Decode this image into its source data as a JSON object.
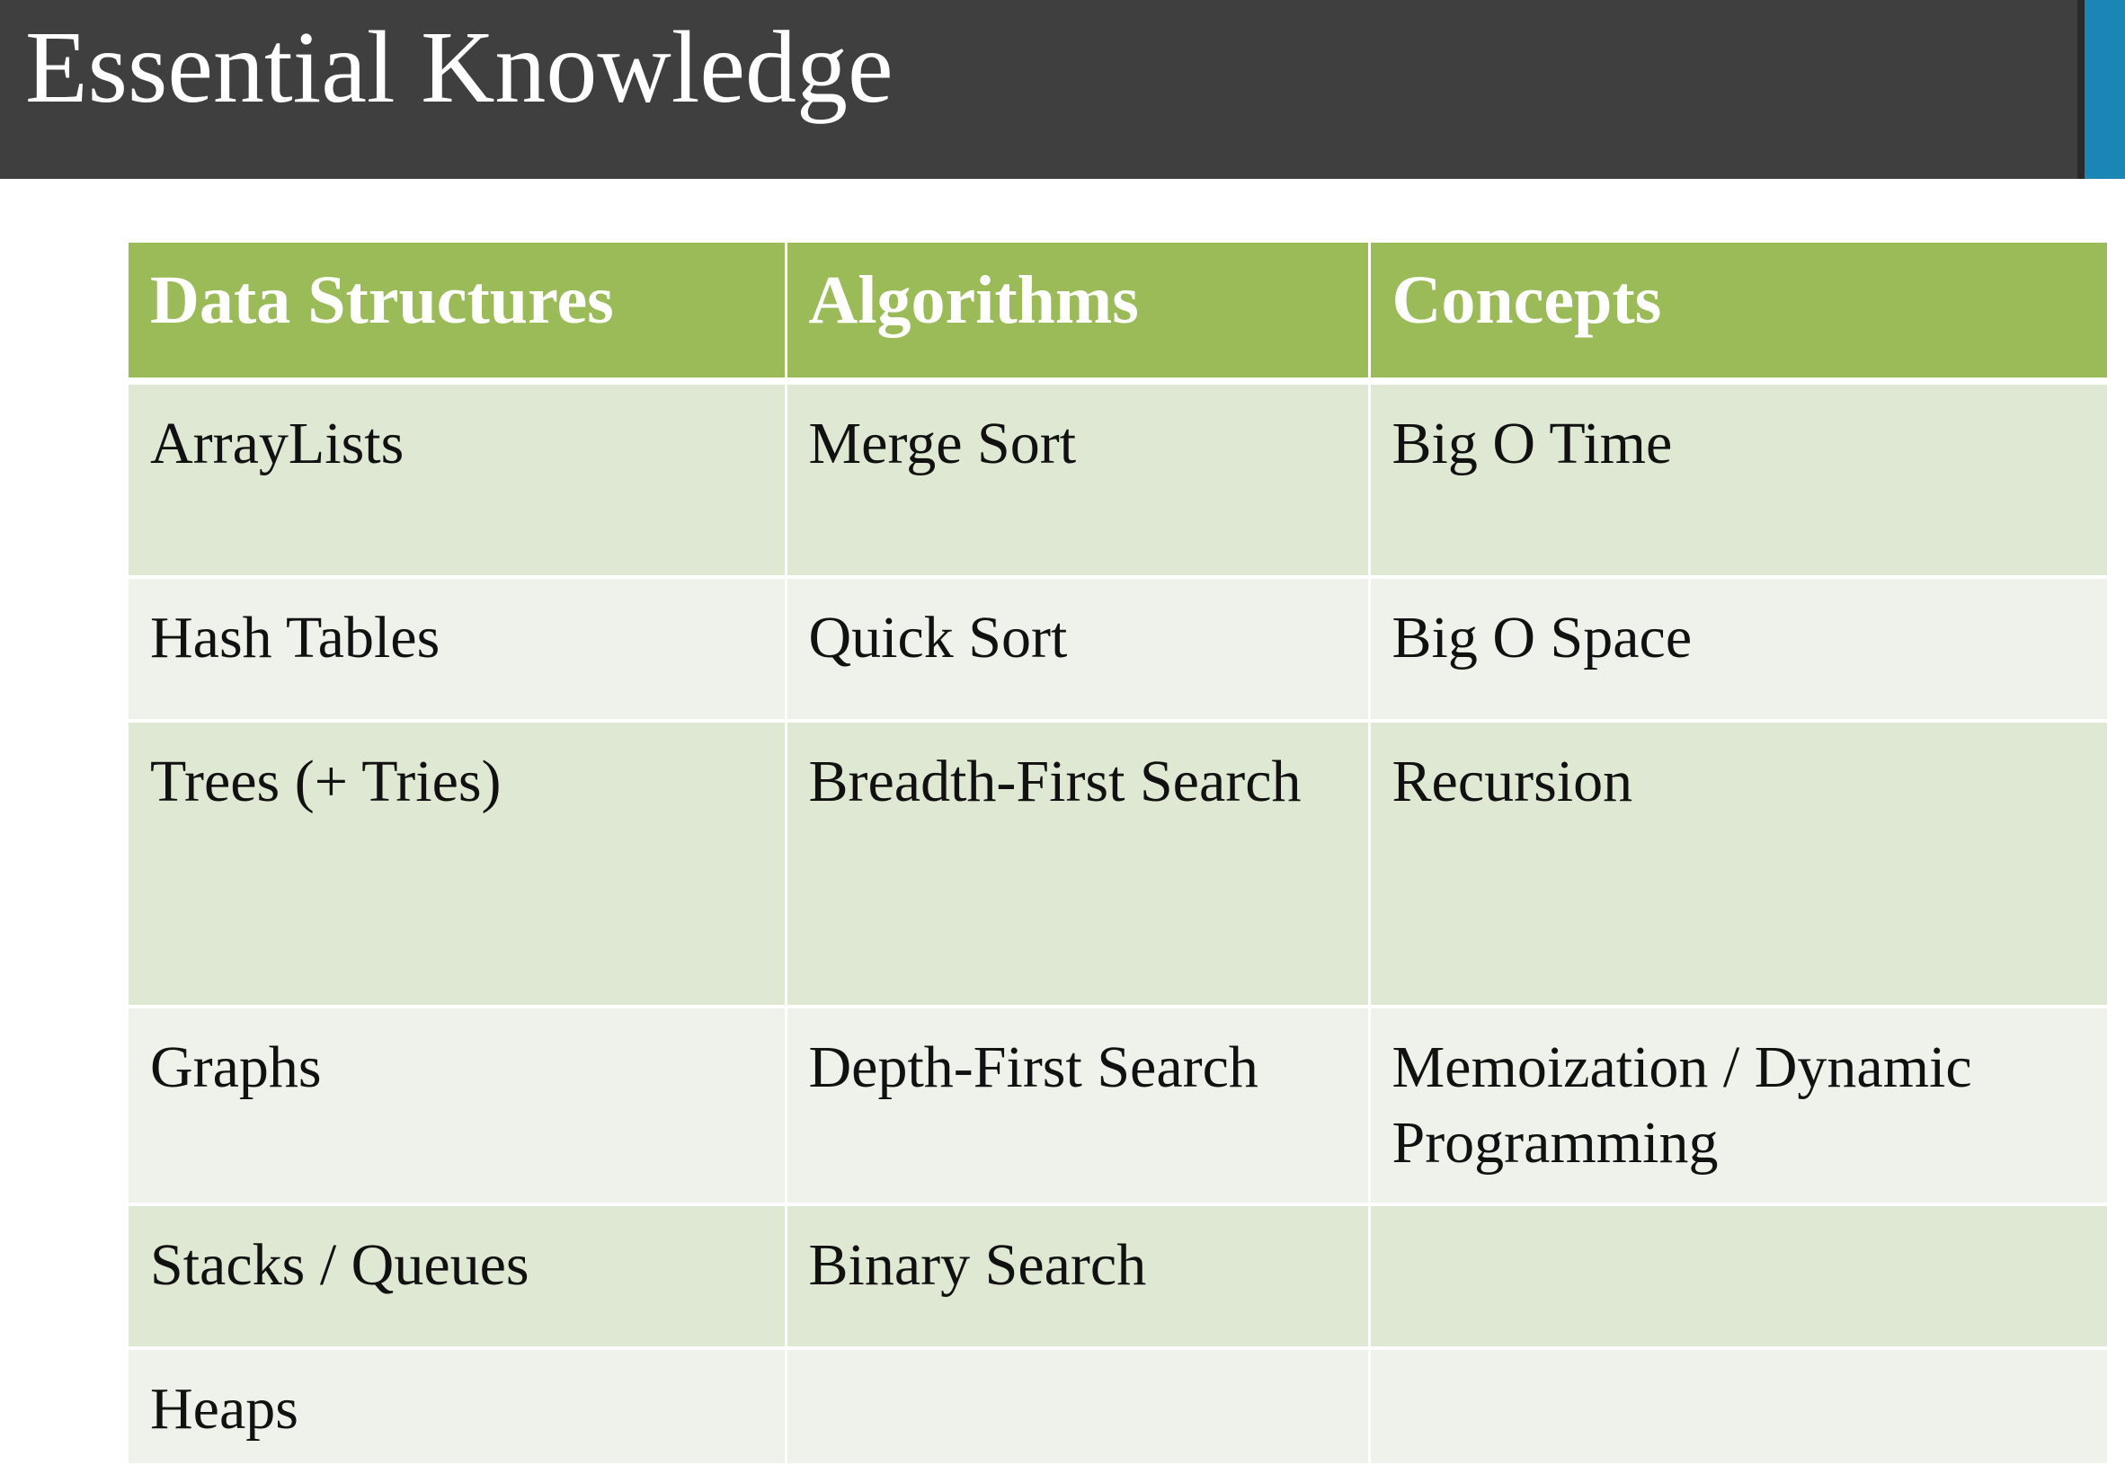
{
  "title": "Essential Knowledge",
  "colors": {
    "title_bar": "#3f3f3f",
    "accent": "#1a86b6",
    "header_green": "#9bbb59",
    "row_band_dark": "#dfe8d3",
    "row_band_light": "#eff2ea"
  },
  "table": {
    "headers": [
      "Data Structures",
      "Algorithms",
      "Concepts"
    ],
    "rows": [
      [
        "ArrayLists",
        "Merge Sort",
        "Big O Time"
      ],
      [
        "Hash Tables",
        "Quick Sort",
        "Big O Space"
      ],
      [
        "Trees (+ Tries)",
        "Breadth-First Search",
        "Recursion"
      ],
      [
        "Graphs",
        "Depth-First Search",
        "Memoization / Dynamic Programming"
      ],
      [
        "Stacks / Queues",
        "Binary Search",
        ""
      ],
      [
        "Heaps",
        "",
        ""
      ]
    ]
  }
}
